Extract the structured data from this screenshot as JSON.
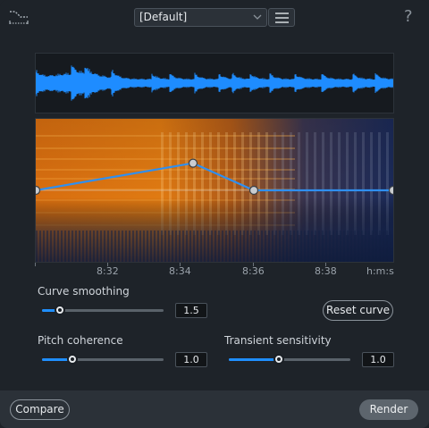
{
  "header": {
    "preset_value": "[Default]",
    "curve_icon": "curve-icon",
    "menu_icon": "hamburger-icon",
    "help_label": "?"
  },
  "timeline": {
    "labels": [
      "8:32",
      "8:34",
      "8:36",
      "8:38"
    ],
    "unit": "h:m:s"
  },
  "controls": {
    "curve_smoothing": {
      "label": "Curve smoothing",
      "value": "1.5",
      "level": 0.15
    },
    "reset_curve": "Reset curve",
    "pitch_coherence": {
      "label": "Pitch coherence",
      "value": "1.0",
      "level": 0.25
    },
    "transient_sensitivity": {
      "label": "Transient sensitivity",
      "value": "1.0",
      "level": 0.41
    }
  },
  "curve": {
    "points": [
      [
        0.0,
        0.5
      ],
      [
        0.44,
        0.31
      ],
      [
        0.61,
        0.5
      ],
      [
        1.0,
        0.5
      ]
    ]
  },
  "footer": {
    "compare": "Compare",
    "render": "Render"
  },
  "colors": {
    "accent": "#1f8fff",
    "waveform": "#1e8cff",
    "spectrogram_hot": "#ff9a1a"
  }
}
